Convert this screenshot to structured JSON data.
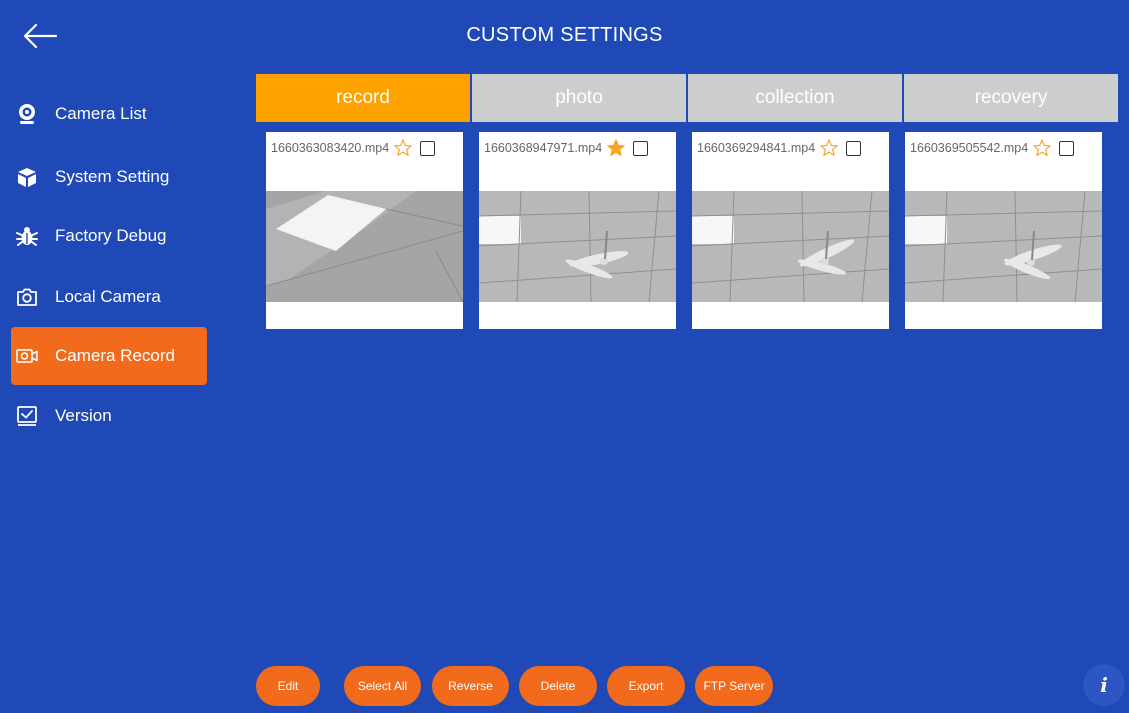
{
  "header": {
    "title": "CUSTOM SETTINGS",
    "back_icon": "arrow-left-icon"
  },
  "sidebar": {
    "items": [
      {
        "label": "Camera List",
        "icon": "webcam-icon",
        "active": false
      },
      {
        "label": "System Setting",
        "icon": "cube-icon",
        "active": false
      },
      {
        "label": "Factory Debug",
        "icon": "bug-icon",
        "active": false
      },
      {
        "label": "Local Camera",
        "icon": "camera-icon",
        "active": false
      },
      {
        "label": "Camera Record",
        "icon": "video-camera-icon",
        "active": true
      },
      {
        "label": "Version",
        "icon": "version-check-icon",
        "active": false
      }
    ]
  },
  "tabs": [
    {
      "label": "record",
      "active": true
    },
    {
      "label": "photo",
      "active": false
    },
    {
      "label": "collection",
      "active": false
    },
    {
      "label": "recovery",
      "active": false
    }
  ],
  "files": [
    {
      "name": "1660363083420.mp4",
      "starred": false,
      "checked": false
    },
    {
      "name": "1660368947971.mp4",
      "starred": true,
      "checked": false
    },
    {
      "name": "1660369294841.mp4",
      "starred": false,
      "checked": false
    },
    {
      "name": "1660369505542.mp4",
      "starred": false,
      "checked": false
    }
  ],
  "actions": {
    "edit": "Edit",
    "select_all": "Select All",
    "reverse": "Reverse",
    "delete": "Delete",
    "export": "Export",
    "ftp_server": "FTP Server"
  },
  "info_label": "i",
  "colors": {
    "background": "#1f49b6",
    "accent_orange": "#f26a1b",
    "tab_active": "#ffa200",
    "tab_inactive": "#cdcdcd",
    "star": "#f5a623"
  }
}
